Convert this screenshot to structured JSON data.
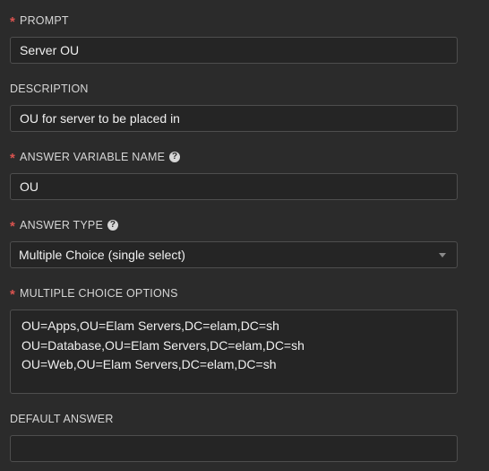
{
  "fields": {
    "prompt": {
      "label": "PROMPT",
      "required": true,
      "value": "Server OU"
    },
    "description": {
      "label": "DESCRIPTION",
      "required": false,
      "value": "OU for server to be placed in"
    },
    "answer_variable_name": {
      "label": "ANSWER VARIABLE NAME",
      "required": true,
      "value": "OU",
      "help_icon": "question-circle-icon"
    },
    "answer_type": {
      "label": "ANSWER TYPE",
      "required": true,
      "value": "Multiple Choice (single select)",
      "help_icon": "question-circle-icon"
    },
    "multiple_choice_options": {
      "label": "MULTIPLE CHOICE OPTIONS",
      "required": true,
      "lines": [
        "OU=Apps,OU=Elam Servers,DC=elam,DC=sh",
        "OU=Database,OU=Elam Servers,DC=elam,DC=sh",
        "OU=Web,OU=Elam Servers,DC=elam,DC=sh"
      ]
    },
    "default_answer": {
      "label": "DEFAULT ANSWER",
      "required": false,
      "value": ""
    }
  },
  "symbols": {
    "required_marker": "*",
    "help_glyph": "?"
  },
  "colors": {
    "background": "#2b2b2b",
    "input_background": "#252525",
    "input_border": "#4e4e4e",
    "required": "#d9534f",
    "text": "#e0e0e0"
  }
}
